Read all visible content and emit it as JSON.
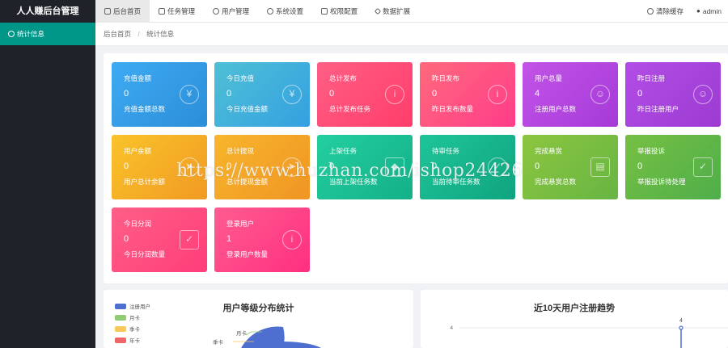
{
  "app": {
    "title": "人人赚后台管理"
  },
  "nav": [
    {
      "label": "后台首页",
      "icon": "home-icon"
    },
    {
      "label": "任务管理",
      "icon": "task-icon"
    },
    {
      "label": "用户管理",
      "icon": "user-icon"
    },
    {
      "label": "系统设置",
      "icon": "gear-icon"
    },
    {
      "label": "权限配置",
      "icon": "lock-icon"
    },
    {
      "label": "数据扩展",
      "icon": "diamond-icon"
    }
  ],
  "top_right": {
    "clear_cache": "清除缓存",
    "user": "admin"
  },
  "sidebar": {
    "items": [
      {
        "label": "统计信息",
        "icon": "dashboard-icon"
      }
    ]
  },
  "breadcrumb": {
    "home": "后台首页",
    "current": "统计信息"
  },
  "cards": [
    {
      "title": "充值金额",
      "value": "0",
      "desc": "充值金额总数",
      "icon": "yen-icon",
      "color_from": "#3eaaf3",
      "color_to": "#2b8ed8"
    },
    {
      "title": "今日充值",
      "value": "0",
      "desc": "今日充值金额",
      "icon": "yen-icon",
      "color_from": "#4fc0d6",
      "color_to": "#35a0e0"
    },
    {
      "title": "总计发布",
      "value": "0",
      "desc": "总计发布任务",
      "icon": "info-icon",
      "color_from": "#ff5f85",
      "color_to": "#ff3d6b"
    },
    {
      "title": "昨日发布",
      "value": "0",
      "desc": "昨日发布数量",
      "icon": "info-icon",
      "color_from": "#ff6a7c",
      "color_to": "#ff3c8a"
    },
    {
      "title": "用户总量",
      "value": "4",
      "desc": "注册用户总数",
      "icon": "user-icon",
      "color_from": "#c254e6",
      "color_to": "#a53ad8"
    },
    {
      "title": "昨日注册",
      "value": "0",
      "desc": "昨日注册用户",
      "icon": "smile-icon",
      "color_from": "#b24ee6",
      "color_to": "#9c3ad2"
    },
    {
      "title": "用户余额",
      "value": "0",
      "desc": "用户总计余额",
      "icon": "paper-plane-icon",
      "color_from": "#f9c32a",
      "color_to": "#f19a23"
    },
    {
      "title": "总计提现",
      "value": "0",
      "desc": "总计提现金额",
      "icon": "paper-plane-icon",
      "color_from": "#f8b62c",
      "color_to": "#ef9524"
    },
    {
      "title": "上架任务",
      "value": "0",
      "desc": "当前上架任务数",
      "icon": "apps-icon",
      "color_from": "#23cfa0",
      "color_to": "#14b088"
    },
    {
      "title": "待审任务",
      "value": "0",
      "desc": "当前待审任务数",
      "icon": "check-circle-icon",
      "color_from": "#1fc59a",
      "color_to": "#0fa47f"
    },
    {
      "title": "完成悬赏",
      "value": "0",
      "desc": "完成悬赏总数",
      "icon": "clipboard-icon",
      "color_from": "#8cc63f",
      "color_to": "#67b543"
    },
    {
      "title": "举报投诉",
      "value": "0",
      "desc": "举报投诉待处理",
      "icon": "shield-icon",
      "color_from": "#76c043",
      "color_to": "#4fae4a"
    },
    {
      "title": "今日分润",
      "value": "0",
      "desc": "今日分润数量",
      "icon": "shield-icon",
      "color_from": "#ff5f87",
      "color_to": "#ff3d7a"
    },
    {
      "title": "登录用户",
      "value": "1",
      "desc": "登录用户数量",
      "icon": "info-icon",
      "color_from": "#ff5c90",
      "color_to": "#ff2f80"
    }
  ],
  "watermark": "https://www.huzhan.com/ishop24426",
  "chart_left": {
    "title": "用户等级分布统计",
    "legend": [
      {
        "label": "注册用户",
        "color": "#4e6fcf"
      },
      {
        "label": "月卡",
        "color": "#91cc75"
      },
      {
        "label": "季卡",
        "color": "#fac858"
      },
      {
        "label": "年卡",
        "color": "#ee6666"
      }
    ],
    "pie_labels": [
      "月卡",
      "季卡"
    ]
  },
  "chart_right": {
    "title": "近10天用户注册趋势",
    "ytick": "4",
    "last_value_label": "4"
  },
  "chart_data": [
    {
      "type": "pie",
      "title": "用户等级分布统计",
      "categories": [
        "注册用户",
        "月卡",
        "季卡",
        "年卡"
      ]
    },
    {
      "type": "line",
      "title": "近10天用户注册趋势",
      "ylim": [
        0,
        4
      ],
      "series": [
        {
          "values": [
            4
          ]
        }
      ]
    }
  ]
}
